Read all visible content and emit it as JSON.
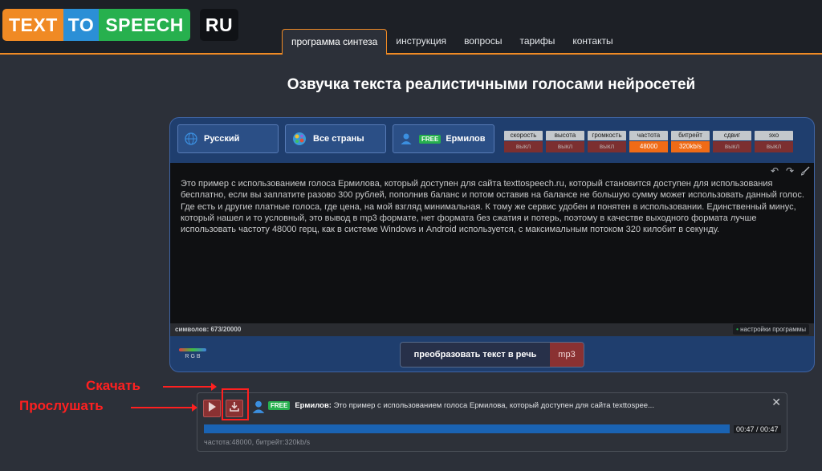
{
  "logo": {
    "part1": "TEXT",
    "part2": "TO",
    "part3": "SPEECH",
    "part4": "RU"
  },
  "nav": {
    "tabs": [
      {
        "label": "программа синтеза",
        "active": true
      },
      {
        "label": "инструкция"
      },
      {
        "label": "вопросы"
      },
      {
        "label": "тарифы"
      },
      {
        "label": "контакты"
      }
    ]
  },
  "page_title": "Озвучка текста реалистичными голосами нейросетей",
  "selectors": {
    "language": "Русский",
    "country": "Все страны",
    "voice_badge": "FREE",
    "voice": "Ермилов"
  },
  "params": [
    {
      "label": "скорость",
      "value": "выкл",
      "active": false
    },
    {
      "label": "высота",
      "value": "выкл",
      "active": false
    },
    {
      "label": "громкость",
      "value": "выкл",
      "active": false
    },
    {
      "label": "частота",
      "value": "48000",
      "active": true
    },
    {
      "label": "битрейт",
      "value": "320kb/s",
      "active": true
    },
    {
      "label": "сдвиг",
      "value": "выкл",
      "active": false
    },
    {
      "label": "эхо",
      "value": "выкл",
      "active": false
    }
  ],
  "editor": {
    "text": "Это пример с использованием голоса Ермилова, который доступен для сайта texttospeech.ru, который становится доступен для использования бесплатно, если вы заплатите разово 300 рублей, пополнив баланс и потом оставив на балансе не большую сумму может использовать данный голос. Где есть и другие платные голоса, где цена, на мой взгляд минимальная. К тому же сервис удобен и понятен в использовании. Единственный минус, который нашел и то условный, это вывод в mp3 формате, нет формата без сжатия и потерь, поэтому в качестве выходного формата лучше использовать частоту 48000 герц, как в системе Windows и Android используется, с максимальным потоком 320 килобит в секунду."
  },
  "status": {
    "count": "символов: 673/20000",
    "settings": "настройки программы"
  },
  "rgb_label": "RGB",
  "convert": {
    "label": "преобразовать текст в речь",
    "format": "mp3"
  },
  "player": {
    "badge": "FREE",
    "voice": "Ермилов:",
    "snippet": "Это пример с использованием голоса Ермилова, который доступен для сайта texttospee...",
    "progress": 1.0,
    "time": "00:47 / 00:47",
    "info": "частота:48000, битрейт:320kb/s",
    "close": "✕"
  },
  "annotations": {
    "download": "Скачать",
    "listen": "Прослушать"
  },
  "colors": {
    "accent": "#f08a24",
    "panel": "#1f3e6e",
    "active_param": "#f06b16",
    "red_button": "#8a3132",
    "annotation": "#ff2020"
  }
}
